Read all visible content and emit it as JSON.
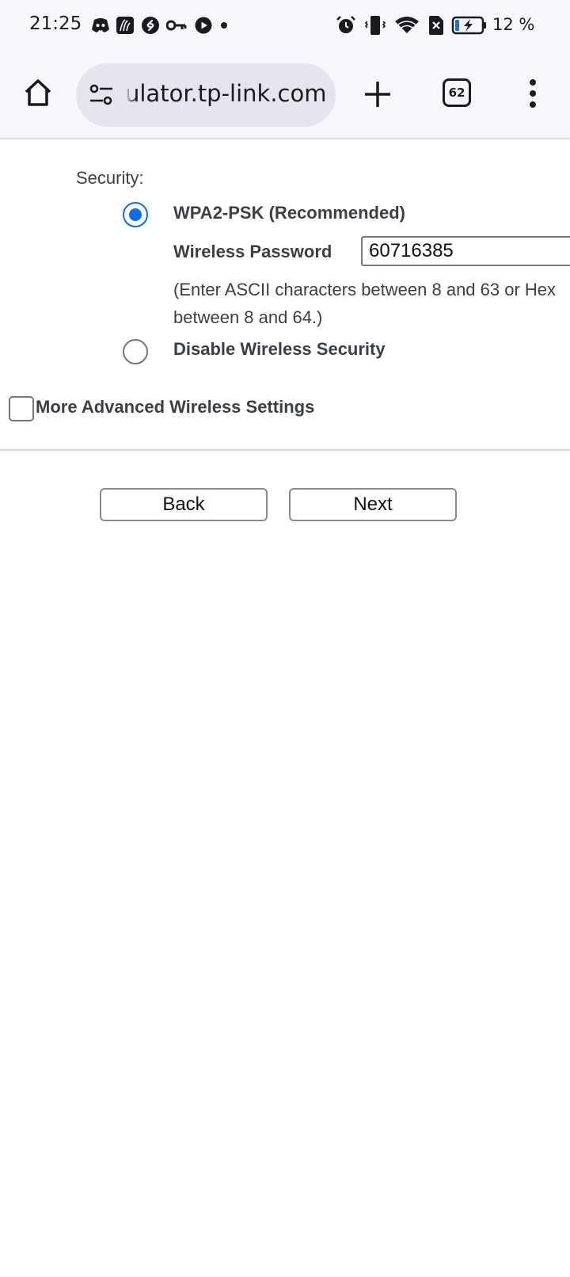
{
  "status_bar": {
    "time": "21:25",
    "notification_icons": [
      "discord-icon",
      "ninja-app-icon",
      "shazam-icon",
      "vpn-key-icon",
      "youtube-play-icon",
      "more-dot-icon"
    ],
    "system_icons": [
      "alarm-icon",
      "vibrate-icon",
      "wifi-icon",
      "no-sim-icon",
      "battery-charging-icon"
    ],
    "battery_percent": "12 %"
  },
  "browser": {
    "url": "ulator.tp-link.com",
    "tab_count": "62"
  },
  "form": {
    "security_label": "Security:",
    "wpa_option_label": "WPA2-PSK (Recommended)",
    "wpa_selected": true,
    "password_label": "Wireless Password",
    "password_value": "60716385",
    "hint_line1": "(Enter ASCII characters between 8 and 63 or Hex",
    "hint_line2": "between 8 and 64.)",
    "disable_option_label": "Disable Wireless Security",
    "advanced_label": "More Advanced Wireless Settings",
    "advanced_checked": false
  },
  "buttons": {
    "back": "Back",
    "next": "Next"
  },
  "colors": {
    "accent": "#0b6dea",
    "toolbar_bg": "#f7f6fc"
  }
}
